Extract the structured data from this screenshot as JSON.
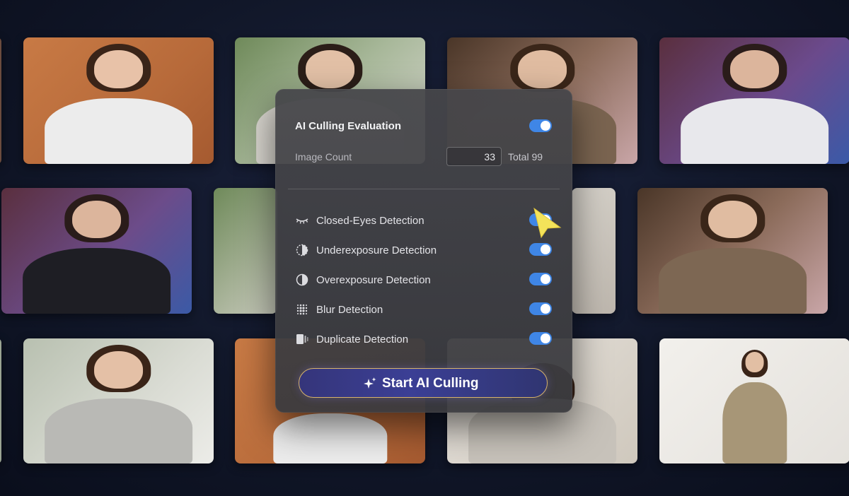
{
  "panel": {
    "title": "AI Culling Evaluation",
    "title_toggle_on": true,
    "image_count_label": "Image Count",
    "image_count_value": "33",
    "total_label": "Total 99",
    "detections": [
      {
        "label": "Closed-Eyes Detection",
        "icon": "closed-eyes-icon",
        "enabled": true
      },
      {
        "label": "Underexposure Detection",
        "icon": "underexposure-icon",
        "enabled": true
      },
      {
        "label": "Overexposure Detection",
        "icon": "overexposure-icon",
        "enabled": true
      },
      {
        "label": "Blur Detection",
        "icon": "blur-icon",
        "enabled": true
      },
      {
        "label": "Duplicate Detection",
        "icon": "duplicate-icon",
        "enabled": true
      }
    ],
    "start_button_label": "Start AI Culling",
    "start_button_icon": "sparkle-icon"
  },
  "colors": {
    "toggle_on": "#3f86e6",
    "button_border": "#d7b46a",
    "button_fill": "#3b3f95",
    "cursor": "#f3e35a"
  },
  "photo_grid": {
    "rows": 3,
    "columns": 4
  }
}
